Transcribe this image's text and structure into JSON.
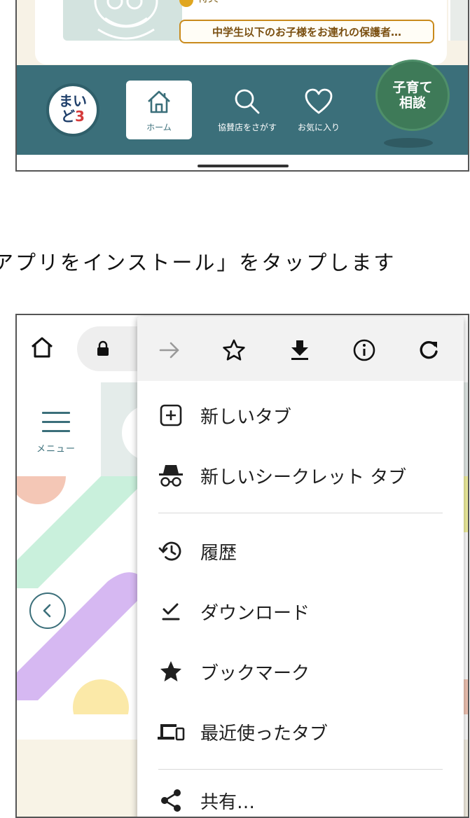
{
  "top_app": {
    "special_label": "特典",
    "special_badge": "中学生以下のお子様をお連れの保護者…",
    "logo_line1": "まい",
    "logo_line2": "ど",
    "logo_mark": "3",
    "nav": {
      "home": "ホーム",
      "search": "協賛店をさがす",
      "favorites": "お気に入り"
    },
    "consult_line1": "子育て",
    "consult_line2": "相談",
    "colors": {
      "nav_bg": "#3b6f7a",
      "consult_bg": "#3e7a58",
      "badge_border": "#c98a1c"
    }
  },
  "instruction": "アプリをインストール」をタップします",
  "browser": {
    "toolbar_icons": [
      "forward-icon",
      "star-icon",
      "download-icon",
      "info-icon",
      "refresh-icon"
    ],
    "page_menu_label": "メニュー",
    "menu_items": [
      {
        "icon": "new-tab-icon",
        "label": "新しいタブ"
      },
      {
        "icon": "incognito-icon",
        "label": "新しいシークレット タブ"
      },
      {
        "icon": "history-icon",
        "label": "履歴"
      },
      {
        "icon": "downloads-icon",
        "label": "ダウンロード"
      },
      {
        "icon": "bookmarks-icon",
        "label": "ブックマーク"
      },
      {
        "icon": "recent-tabs-icon",
        "label": "最近使ったタブ"
      },
      {
        "icon": "share-icon",
        "label": "共有…"
      }
    ]
  }
}
